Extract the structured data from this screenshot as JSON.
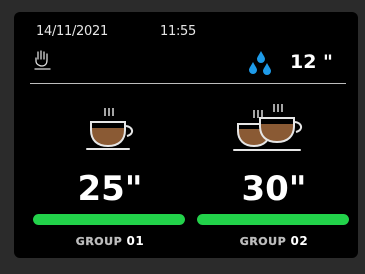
{
  "status_bar": {
    "date": "14/11/2021",
    "time": "11:55",
    "timer_value": "12 \""
  },
  "groups": [
    {
      "label": "GROUP",
      "number": "01",
      "shot_time": "25\"",
      "progress": 1.0,
      "cup_type": "single-cup-icon"
    },
    {
      "label": "GROUP",
      "number": "02",
      "shot_time": "30\"",
      "progress": 1.0,
      "cup_type": "double-cup-icon"
    }
  ],
  "colors": {
    "background": "#000000",
    "progress_fill": "#22d24a",
    "water_drops": "#1e9be9",
    "coffee": "#8a5a34"
  },
  "icons": [
    "steam-icon",
    "water-drops-icon",
    "single-cup-icon",
    "double-cup-icon"
  ]
}
